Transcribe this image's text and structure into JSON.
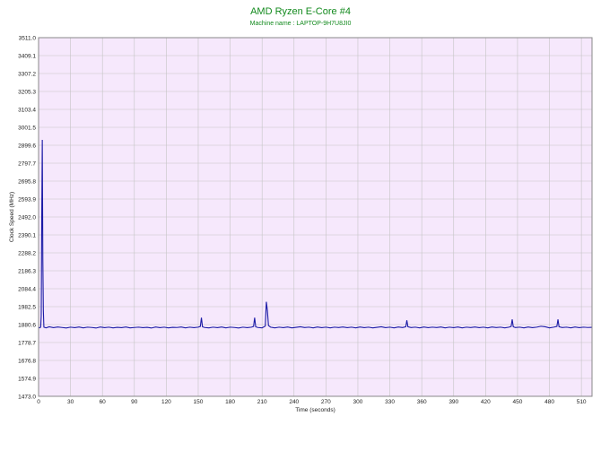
{
  "chart_data": {
    "type": "line",
    "title": "AMD Ryzen E-Core #4",
    "subtitle": "Machine name : LAPTOP-9H7U8JI0",
    "xlabel": "Time (seconds)",
    "ylabel": "Clock Speed (MHz)",
    "xlim": [
      0,
      520
    ],
    "ylim": [
      1473.0,
      3511.0
    ],
    "x_ticks": [
      "0",
      "30",
      "60",
      "90",
      "120",
      "150",
      "180",
      "210",
      "240",
      "270",
      "300",
      "330",
      "360",
      "390",
      "420",
      "450",
      "480",
      "510"
    ],
    "y_ticks": [
      "1473.0",
      "1574.9",
      "1676.8",
      "1778.7",
      "1880.6",
      "1982.5",
      "2084.4",
      "2186.3",
      "2288.2",
      "2390.1",
      "2492.0",
      "2593.9",
      "2695.8",
      "2797.7",
      "2899.6",
      "3001.5",
      "3103.4",
      "3205.3",
      "3307.2",
      "3409.1",
      "3511.0"
    ],
    "grid": true,
    "colors": {
      "line": "#1a1aa6",
      "plot_bg": "#f6e8fc",
      "grid": "#c4c4c4",
      "title": "#138a1e"
    },
    "series": [
      {
        "values": [
          [
            0,
            1865
          ],
          [
            1,
            1862
          ],
          [
            2,
            1866
          ],
          [
            2.5,
            1930
          ],
          [
            3,
            2500
          ],
          [
            3.5,
            2930
          ],
          [
            4,
            2250
          ],
          [
            4.5,
            1960
          ],
          [
            5,
            1866
          ],
          [
            7,
            1862
          ],
          [
            10,
            1868
          ],
          [
            14,
            1863
          ],
          [
            18,
            1867
          ],
          [
            22,
            1864
          ],
          [
            26,
            1861
          ],
          [
            30,
            1866
          ],
          [
            34,
            1863
          ],
          [
            38,
            1867
          ],
          [
            42,
            1862
          ],
          [
            46,
            1866
          ],
          [
            50,
            1864
          ],
          [
            54,
            1861
          ],
          [
            58,
            1867
          ],
          [
            62,
            1863
          ],
          [
            66,
            1866
          ],
          [
            70,
            1862
          ],
          [
            74,
            1865
          ],
          [
            78,
            1863
          ],
          [
            82,
            1867
          ],
          [
            86,
            1862
          ],
          [
            90,
            1864
          ],
          [
            94,
            1866
          ],
          [
            98,
            1863
          ],
          [
            102,
            1865
          ],
          [
            106,
            1861
          ],
          [
            110,
            1867
          ],
          [
            114,
            1863
          ],
          [
            118,
            1866
          ],
          [
            122,
            1862
          ],
          [
            126,
            1865
          ],
          [
            130,
            1864
          ],
          [
            134,
            1867
          ],
          [
            138,
            1862
          ],
          [
            142,
            1866
          ],
          [
            146,
            1863
          ],
          [
            150,
            1866
          ],
          [
            152,
            1870
          ],
          [
            153,
            1920
          ],
          [
            154,
            1868
          ],
          [
            156,
            1864
          ],
          [
            160,
            1862
          ],
          [
            164,
            1866
          ],
          [
            168,
            1863
          ],
          [
            172,
            1867
          ],
          [
            176,
            1862
          ],
          [
            180,
            1866
          ],
          [
            184,
            1864
          ],
          [
            188,
            1861
          ],
          [
            192,
            1866
          ],
          [
            196,
            1863
          ],
          [
            200,
            1866
          ],
          [
            202,
            1870
          ],
          [
            203,
            1920
          ],
          [
            204,
            1868
          ],
          [
            206,
            1864
          ],
          [
            210,
            1862
          ],
          [
            213,
            1872
          ],
          [
            214,
            2010
          ],
          [
            215,
            1960
          ],
          [
            216,
            1875
          ],
          [
            218,
            1866
          ],
          [
            222,
            1862
          ],
          [
            226,
            1866
          ],
          [
            230,
            1863
          ],
          [
            234,
            1867
          ],
          [
            238,
            1862
          ],
          [
            242,
            1865
          ],
          [
            246,
            1868
          ],
          [
            250,
            1864
          ],
          [
            254,
            1866
          ],
          [
            258,
            1862
          ],
          [
            262,
            1867
          ],
          [
            266,
            1863
          ],
          [
            270,
            1866
          ],
          [
            274,
            1862
          ],
          [
            278,
            1866
          ],
          [
            282,
            1864
          ],
          [
            286,
            1867
          ],
          [
            290,
            1863
          ],
          [
            294,
            1866
          ],
          [
            298,
            1862
          ],
          [
            302,
            1867
          ],
          [
            306,
            1863
          ],
          [
            310,
            1866
          ],
          [
            314,
            1862
          ],
          [
            318,
            1865
          ],
          [
            322,
            1868
          ],
          [
            326,
            1863
          ],
          [
            330,
            1866
          ],
          [
            334,
            1862
          ],
          [
            338,
            1867
          ],
          [
            342,
            1864
          ],
          [
            345,
            1868
          ],
          [
            346,
            1905
          ],
          [
            347,
            1868
          ],
          [
            350,
            1864
          ],
          [
            354,
            1866
          ],
          [
            358,
            1862
          ],
          [
            362,
            1867
          ],
          [
            366,
            1863
          ],
          [
            370,
            1866
          ],
          [
            374,
            1864
          ],
          [
            378,
            1867
          ],
          [
            382,
            1862
          ],
          [
            386,
            1866
          ],
          [
            390,
            1863
          ],
          [
            394,
            1867
          ],
          [
            398,
            1862
          ],
          [
            402,
            1866
          ],
          [
            406,
            1864
          ],
          [
            410,
            1867
          ],
          [
            414,
            1863
          ],
          [
            418,
            1866
          ],
          [
            422,
            1862
          ],
          [
            426,
            1867
          ],
          [
            430,
            1864
          ],
          [
            434,
            1866
          ],
          [
            438,
            1862
          ],
          [
            442,
            1866
          ],
          [
            444,
            1870
          ],
          [
            445,
            1910
          ],
          [
            446,
            1868
          ],
          [
            448,
            1864
          ],
          [
            452,
            1866
          ],
          [
            456,
            1862
          ],
          [
            460,
            1867
          ],
          [
            464,
            1863
          ],
          [
            468,
            1866
          ],
          [
            472,
            1871
          ],
          [
            476,
            1868
          ],
          [
            480,
            1862
          ],
          [
            484,
            1866
          ],
          [
            487,
            1870
          ],
          [
            488,
            1910
          ],
          [
            489,
            1868
          ],
          [
            492,
            1864
          ],
          [
            496,
            1866
          ],
          [
            500,
            1862
          ],
          [
            504,
            1867
          ],
          [
            508,
            1863
          ],
          [
            512,
            1866
          ],
          [
            516,
            1864
          ],
          [
            520,
            1865
          ]
        ]
      }
    ]
  }
}
